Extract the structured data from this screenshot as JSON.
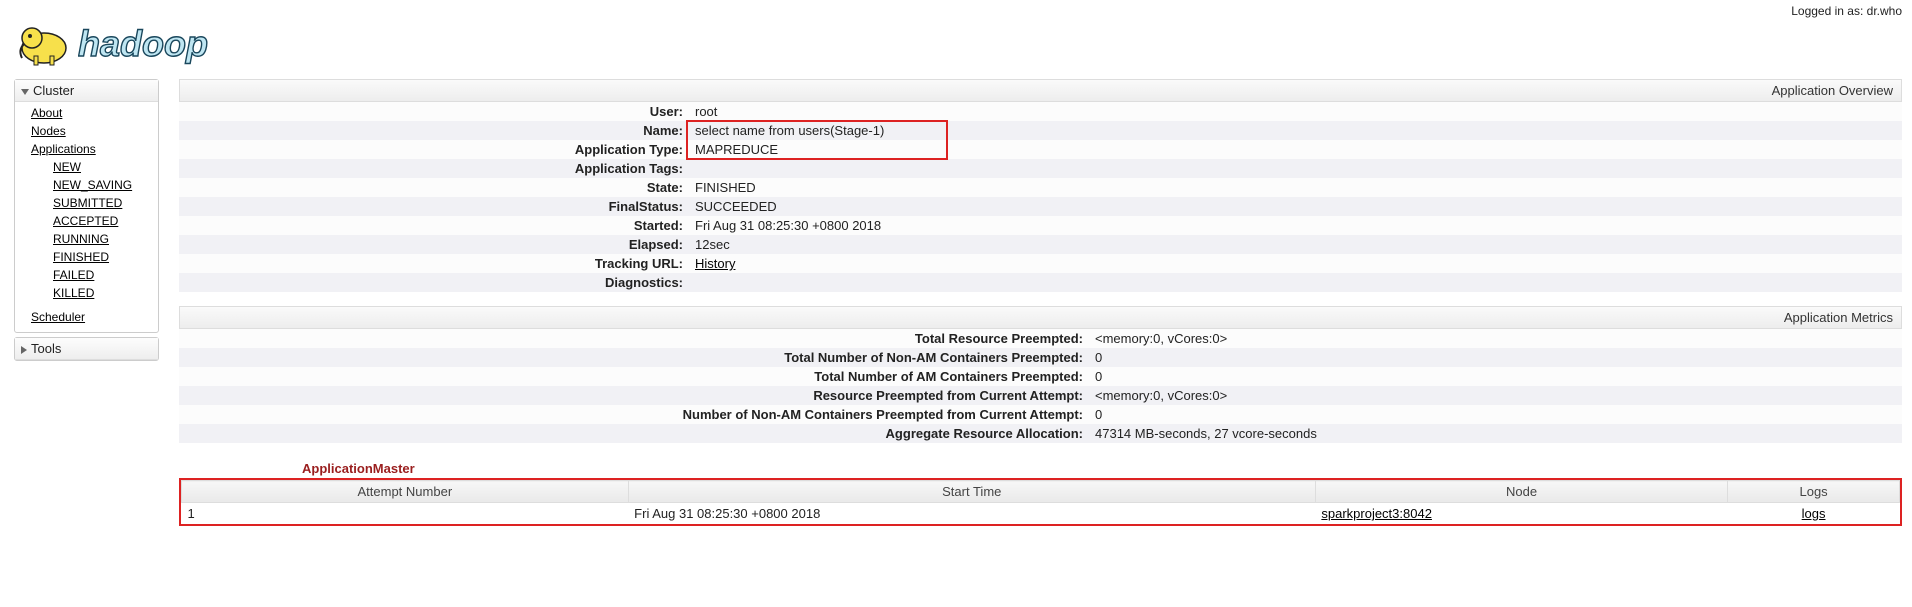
{
  "header": {
    "logged_in_prefix": "Logged in as: ",
    "logged_in_user": "dr.who",
    "logo_text": "hadoop"
  },
  "sidebar": {
    "cluster": {
      "title": "Cluster",
      "links": [
        "About",
        "Nodes",
        "Applications"
      ],
      "app_states": [
        "NEW",
        "NEW_SAVING",
        "SUBMITTED",
        "ACCEPTED",
        "RUNNING",
        "FINISHED",
        "FAILED",
        "KILLED"
      ],
      "scheduler": "Scheduler"
    },
    "tools": {
      "title": "Tools"
    }
  },
  "overview": {
    "title": "Application Overview",
    "rows": [
      {
        "k": "User:",
        "v": "root"
      },
      {
        "k": "Name:",
        "v": "select name from users(Stage-1)",
        "hl": true
      },
      {
        "k": "Application Type:",
        "v": "MAPREDUCE",
        "hl": true
      },
      {
        "k": "Application Tags:",
        "v": ""
      },
      {
        "k": "State:",
        "v": "FINISHED"
      },
      {
        "k": "FinalStatus:",
        "v": "SUCCEEDED"
      },
      {
        "k": "Started:",
        "v": "Fri Aug 31 08:25:30 +0800 2018"
      },
      {
        "k": "Elapsed:",
        "v": "12sec"
      },
      {
        "k": "Tracking URL:",
        "v": "History",
        "link": true
      },
      {
        "k": "Diagnostics:",
        "v": ""
      }
    ]
  },
  "metrics": {
    "title": "Application Metrics",
    "rows": [
      {
        "k": "Total Resource Preempted:",
        "v": "<memory:0, vCores:0>"
      },
      {
        "k": "Total Number of Non-AM Containers Preempted:",
        "v": "0"
      },
      {
        "k": "Total Number of AM Containers Preempted:",
        "v": "0"
      },
      {
        "k": "Resource Preempted from Current Attempt:",
        "v": "<memory:0, vCores:0>"
      },
      {
        "k": "Number of Non-AM Containers Preempted from Current Attempt:",
        "v": "0"
      },
      {
        "k": "Aggregate Resource Allocation:",
        "v": "47314 MB-seconds, 27 vcore-seconds"
      }
    ]
  },
  "am": {
    "title": "ApplicationMaster",
    "columns": [
      "Attempt Number",
      "Start Time",
      "Node",
      "Logs"
    ],
    "rows": [
      {
        "attempt": "1",
        "start": "Fri Aug 31 08:25:30 +0800 2018",
        "node": "sparkproject3:8042",
        "logs": "logs"
      }
    ]
  }
}
